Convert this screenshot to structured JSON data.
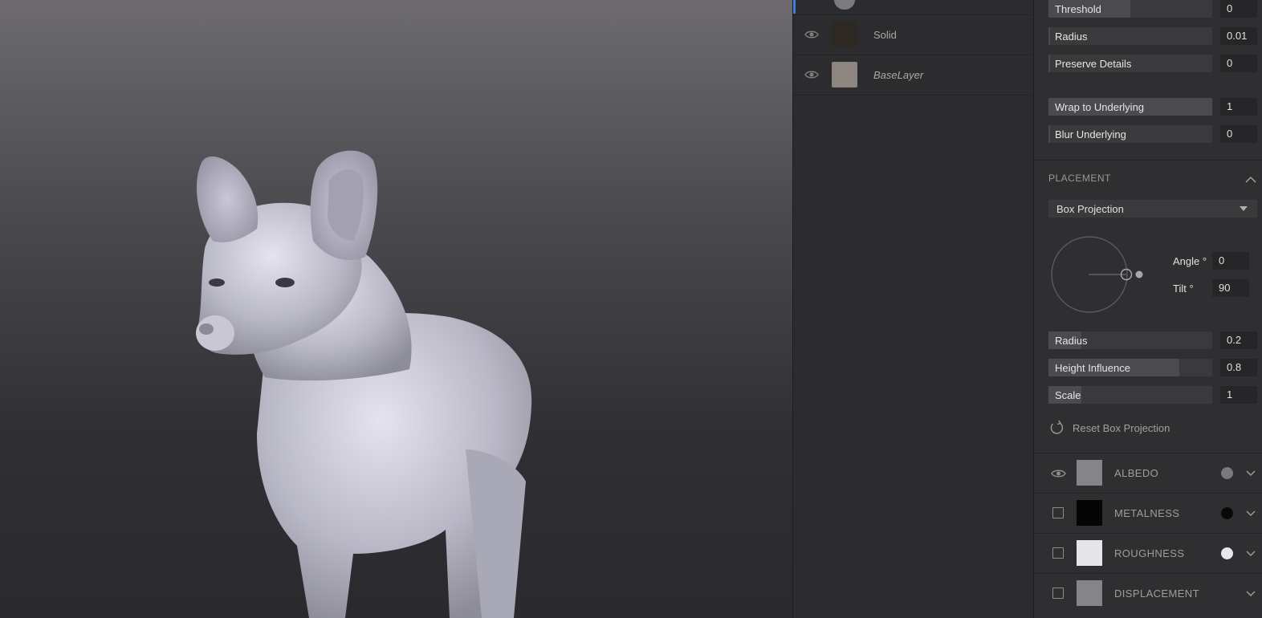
{
  "layers": [
    {
      "name": "Solid",
      "thumb_color": "#2e2822",
      "italic": false
    },
    {
      "name": "BaseLayer",
      "thumb_color": "#8c8580",
      "italic": true
    }
  ],
  "props": {
    "top_sliders": [
      {
        "label": "Threshold",
        "value": "0",
        "level": 0.5
      },
      {
        "label": "Radius",
        "value": "0.01",
        "level": 0.01
      },
      {
        "label": "Preserve Details",
        "value": "0",
        "level": 0.0
      }
    ],
    "wrap_sliders": [
      {
        "label": "Wrap to Underlying",
        "value": "1",
        "level": 1.0
      },
      {
        "label": "Blur Underlying",
        "value": "0",
        "level": 0.0
      }
    ],
    "placement": {
      "title": "PLACEMENT",
      "projection": "Box Projection",
      "angle_label": "Angle °",
      "angle_value": "0",
      "tilt_label": "Tilt °",
      "tilt_value": "90",
      "sliders": [
        {
          "label": "Radius",
          "value": "0.2",
          "level": 0.2
        },
        {
          "label": "Height Influence",
          "value": "0.8",
          "level": 0.8
        },
        {
          "label": "Scale",
          "value": "1",
          "level": 0.02
        }
      ],
      "reset_label": "Reset Box Projection"
    },
    "channels": [
      {
        "name": "ALBEDO",
        "visible": true,
        "swatch": "#858587",
        "dot": "#7a7a7c",
        "icon": "eye-icon"
      },
      {
        "name": "METALNESS",
        "visible": false,
        "swatch": "#050505",
        "dot": "#080808",
        "icon": "checkbox"
      },
      {
        "name": "ROUGHNESS",
        "visible": false,
        "swatch": "#e6e6e8",
        "dot": "#e8e8ea",
        "icon": "checkbox"
      },
      {
        "name": "DISPLACEMENT",
        "visible": false,
        "swatch": "#858587",
        "dot": "",
        "icon": "checkbox"
      }
    ]
  },
  "colors": {
    "accent": "#3b7fd6",
    "panel": "#2f2f31",
    "slider_bg": "#3a3a3d"
  }
}
